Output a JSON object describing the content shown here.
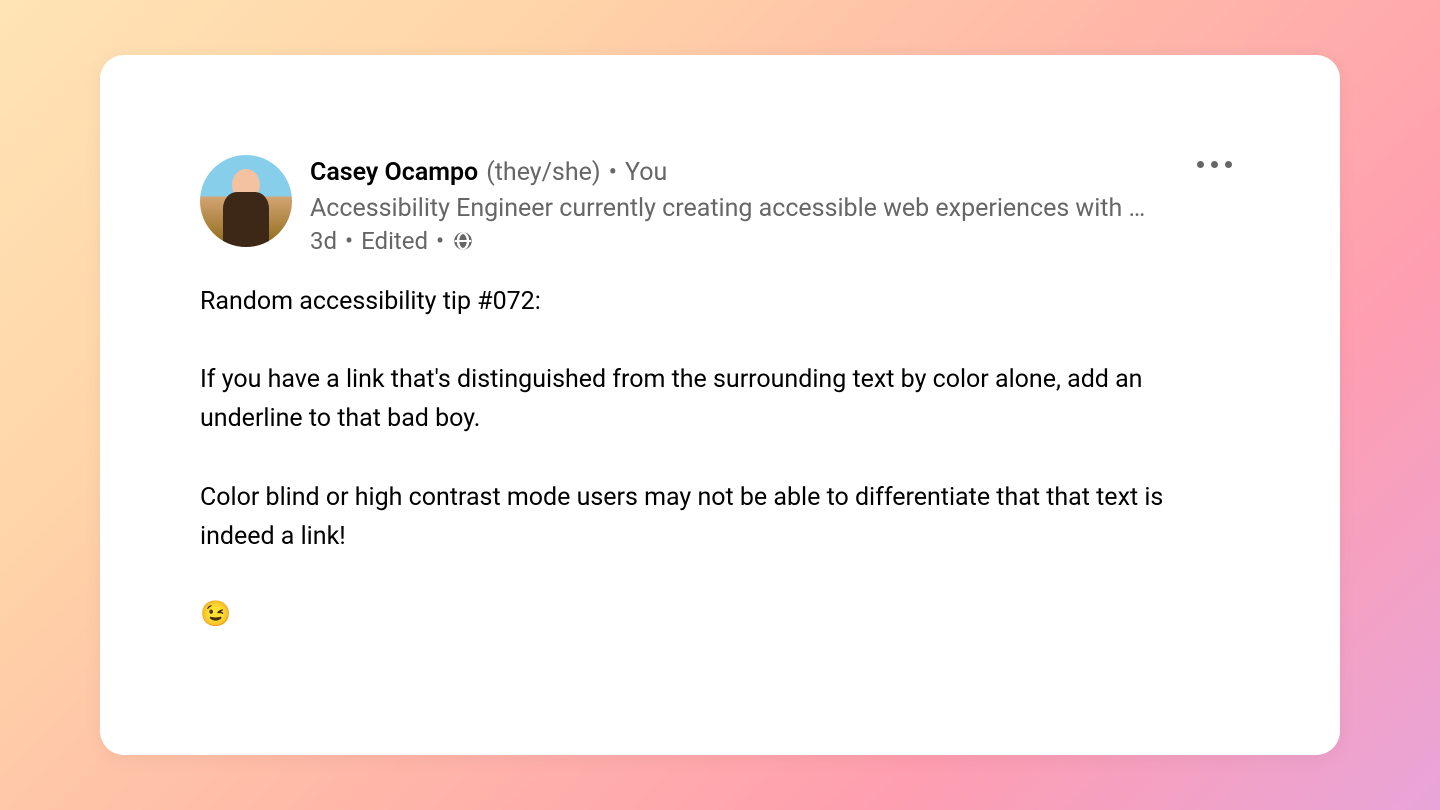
{
  "post": {
    "author": {
      "name": "Casey Ocampo",
      "pronouns": "(they/she)",
      "viewerRelation": "You",
      "headline": "Accessibility Engineer currently creating accessible web experiences with …"
    },
    "meta": {
      "time": "3d",
      "editedLabel": "Edited"
    },
    "body": {
      "p1": "Random accessibility tip #072:",
      "p2": "If you have a link that's distinguished from the surrounding text by color alone, add an underline to that bad boy.",
      "p3": "Color blind or high contrast mode users may not be able to differentiate that that text is indeed a link!",
      "p4": "😉"
    }
  },
  "separator": "•"
}
